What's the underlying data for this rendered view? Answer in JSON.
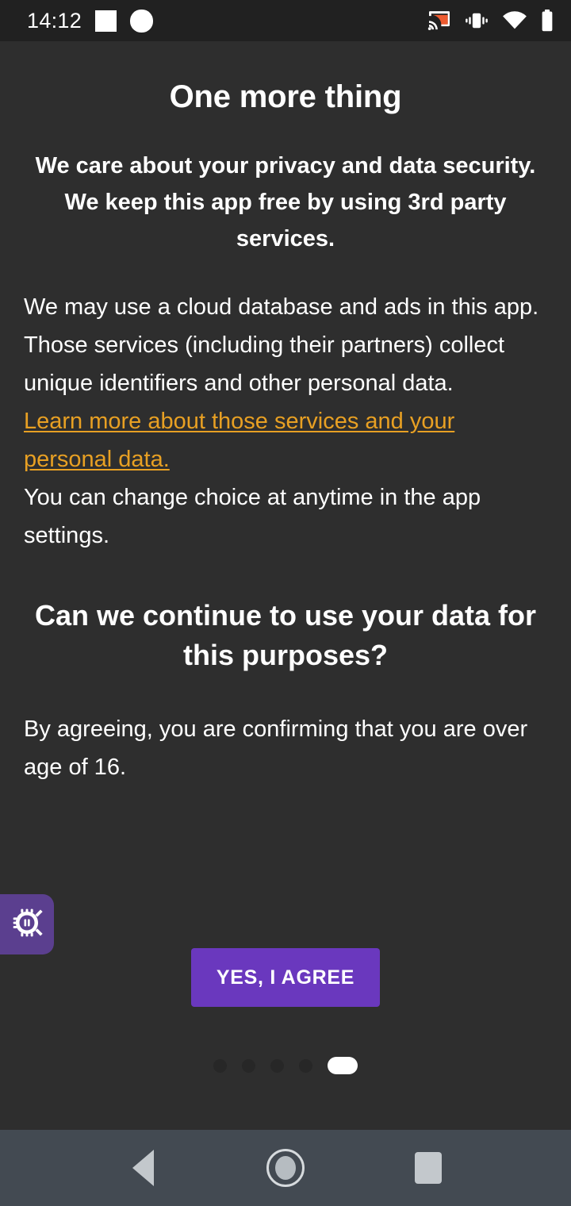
{
  "status_bar": {
    "time": "14:12",
    "left_icons": [
      "notification-square-glyph",
      "notification-circle-glyph"
    ],
    "right_icons": [
      "cast-icon",
      "vibrate-icon",
      "wifi-icon",
      "battery-icon"
    ],
    "cast_color": "#ed5b30",
    "background": "#212121"
  },
  "screen": {
    "title": "One more thing",
    "subtitle_line1": "We care about your privacy and data security.",
    "subtitle_line2": "We keep this app free by using 3rd party services.",
    "body_paragraph": "We may use a cloud database and ads in this app. Those services (including their partners) collect unique identifiers and other personal data.",
    "link_text": "Learn more about those services and your personal data.",
    "settings_note": "You can change choice at anytime in the app settings.",
    "question": "Can we continue to use your data for this purposes?",
    "age_disclaimer": "By agreeing, you are confirming that you are over age of 16.",
    "background": "#2e2e2e",
    "link_color": "#e8a023",
    "accent_color": "#6a38be"
  },
  "agree_button": {
    "label": "YES, I AGREE",
    "color": "#6a38be"
  },
  "debug_tab": {
    "icon": "bug-icon",
    "color": "#5b3f8f"
  },
  "pager": {
    "total": 5,
    "active_index": 4,
    "dots": [
      "page-dot-1",
      "page-dot-2",
      "page-dot-3",
      "page-dot-4",
      "page-dot-5"
    ]
  },
  "nav_bar": {
    "back_label": "back-icon",
    "home_label": "home-icon",
    "recents_label": "recents-icon",
    "background": "#434a52"
  }
}
